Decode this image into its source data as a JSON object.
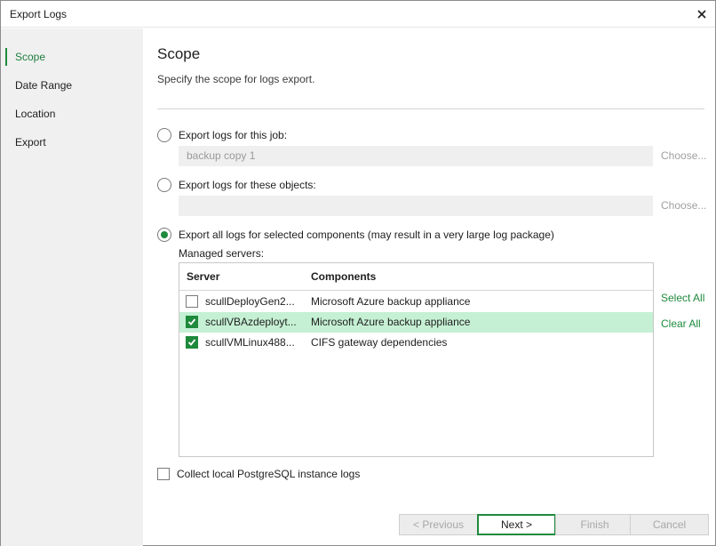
{
  "window": {
    "title": "Export Logs"
  },
  "sidebar": {
    "items": [
      {
        "label": "Scope",
        "active": true
      },
      {
        "label": "Date Range",
        "active": false
      },
      {
        "label": "Location",
        "active": false
      },
      {
        "label": "Export",
        "active": false
      }
    ]
  },
  "main": {
    "heading": "Scope",
    "subtitle": "Specify the scope for logs export.",
    "options": {
      "job": {
        "label": "Export logs for this job:",
        "value": "backup copy 1",
        "choose": "Choose...",
        "selected": false
      },
      "objects": {
        "label": "Export logs for these objects:",
        "value": "",
        "choose": "Choose...",
        "selected": false
      },
      "components": {
        "label": "Export all logs for selected components (may result in a very large log package)",
        "selected": true
      }
    },
    "managed_label": "Managed servers:",
    "table": {
      "headers": {
        "server": "Server",
        "components": "Components"
      },
      "rows": [
        {
          "server": "scullDeployGen2...",
          "component": "Microsoft Azure backup appliance",
          "checked": false,
          "selected": false
        },
        {
          "server": "scullVBAzdeployt...",
          "component": "Microsoft Azure backup appliance",
          "checked": true,
          "selected": true
        },
        {
          "server": "scullVMLinux488...",
          "component": "CIFS gateway dependencies",
          "checked": true,
          "selected": false
        }
      ]
    },
    "select_all": "Select All",
    "clear_all": "Clear All",
    "collect_postgres": {
      "label": "Collect local PostgreSQL instance logs",
      "checked": false
    }
  },
  "footer": {
    "previous": "< Previous",
    "next": "Next >",
    "finish": "Finish",
    "cancel": "Cancel"
  },
  "colors": {
    "accent": "#1e8a3c",
    "selected_row": "#c5f0d4",
    "sidebar_bg": "#f0f0f0"
  }
}
